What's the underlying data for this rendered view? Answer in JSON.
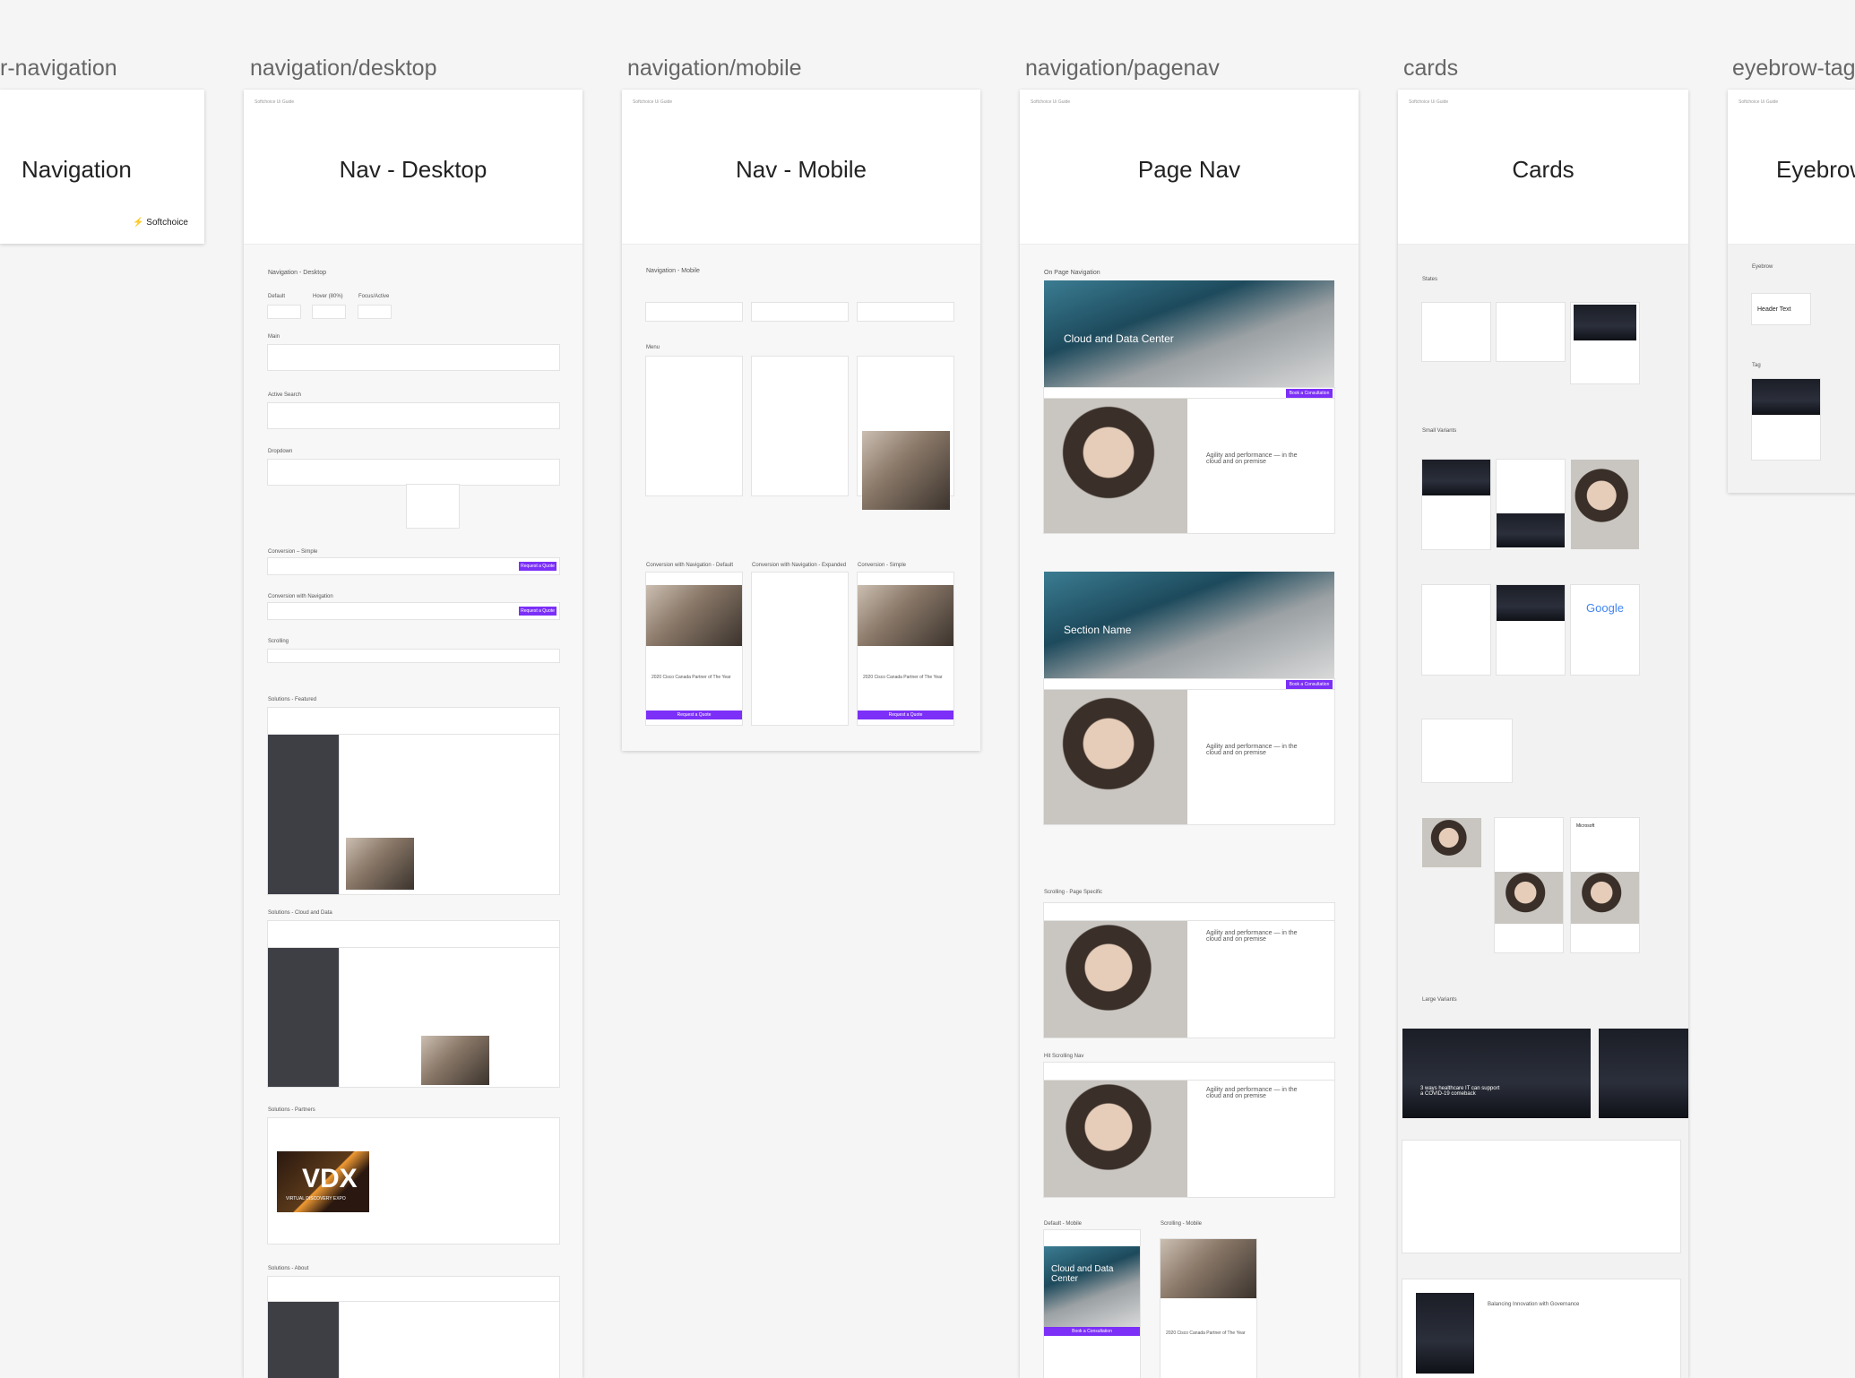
{
  "frames": [
    {
      "label": "r-navigation",
      "title": "Navigation",
      "brand": "Softchoice"
    },
    {
      "label": "navigation/desktop",
      "title": "Nav - Desktop",
      "section": "Navigation - Desktop"
    },
    {
      "label": "navigation/mobile",
      "title": "Nav - Mobile",
      "section": "Navigation - Mobile"
    },
    {
      "label": "navigation/pagenav",
      "title": "Page Nav",
      "section": "On Page Navigation"
    },
    {
      "label": "cards",
      "title": "Cards",
      "section": "States"
    },
    {
      "label": "eyebrow-tag",
      "title": "Eyebrow",
      "section": "Eyebrow"
    }
  ],
  "crumb": "Softchoice Ui Guide",
  "desktop": {
    "states": [
      "Default",
      "Hover (80%)",
      "Focus/Active"
    ],
    "rows": [
      "Main",
      "Active Search",
      "Dropdown",
      "Conversion – Simple",
      "Conversion with Navigation",
      "Scrolling",
      "Solutions - Featured",
      "Solutions - Cloud and Data",
      "Solutions - Partners",
      "Solutions - About"
    ],
    "cta": "Request a Quote",
    "vdx": "VDX",
    "vdx_sub": "VIRTUAL DISCOVERY EXPO"
  },
  "mobile": {
    "rows": [
      "Navigation - Mobile",
      "Menu",
      "Conversion with Navigation - Default",
      "Conversion with Navigation - Expanded",
      "Conversion - Simple"
    ],
    "headline": "2020 Cisco Canada Partner of The Year",
    "cta": "Request a Quote"
  },
  "pagenav": {
    "hero1": "Cloud and Data Center",
    "hero2": "Section Name",
    "heading": "Agility and performance — in the cloud and on premise",
    "cta": "Book a Consultation",
    "rows": [
      "Scrolling - Page Specific",
      "Hit Scrolling Nav",
      "Default - Mobile",
      "Scrolling - Mobile"
    ],
    "mobile_hero": "Cloud and Data Center",
    "mobile_headline": "2020 Cisco Canada Partner of The Year"
  },
  "cards": {
    "groups": [
      "States",
      "Small Variants",
      "Large Variants"
    ],
    "partner": "Google",
    "ms": "Microsoft",
    "large_title": "3 ways healthcare IT can support a COVID-19 comeback",
    "split_title": "Balancing Innovation with Governance"
  },
  "eyebrow": {
    "header": "Header Text",
    "tag": "Tag"
  },
  "colors": {
    "accent": "#7b2ff7",
    "brand": "#f05a28",
    "dark": "#3d3f45"
  }
}
